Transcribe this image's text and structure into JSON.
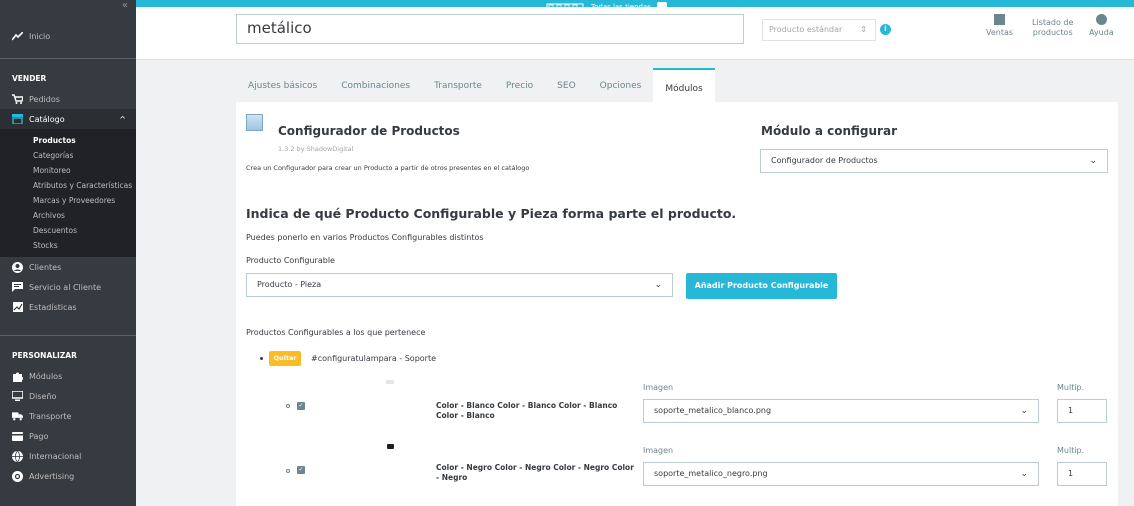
{
  "sidebar": {
    "collapse": "«",
    "home": "Inicio",
    "sell_section": "VENDER",
    "orders": "Pedidos",
    "catalog": "Catálogo",
    "catalog_sub": [
      "Productos",
      "Categorías",
      "Monitoreo",
      "Atributos y Características",
      "Marcas y Proveedores",
      "Archivos",
      "Descuentos",
      "Stocks"
    ],
    "clients": "Clientes",
    "customer_service": "Servicio al Cliente",
    "stats": "Estadísticas",
    "customize_section": "PERSONALIZAR",
    "modules": "Módulos",
    "design": "Diseño",
    "shipping": "Transporte",
    "payment": "Pago",
    "international": "Internacional",
    "advertising": "Advertising"
  },
  "header": {
    "store_toggle_label": "Todas las tiendas",
    "product_name": "metálico",
    "product_type": "Producto estándar",
    "sales": "Ventas",
    "product_list_line1": "Listado de",
    "product_list_line2": "productos",
    "help": "Ayuda"
  },
  "tabs": [
    "Ajustes básicos",
    "Combinaciones",
    "Transporte",
    "Precio",
    "SEO",
    "Opciones",
    "Módulos"
  ],
  "module": {
    "title": "Configurador de Productos",
    "version": "1.3.2 by ShadowDigital",
    "description": "Crea un Configurador para crear un Producto a partir de otros presentes en el catálogo",
    "configure_title": "Módulo a configurar",
    "configure_select": "Configurador de Productos"
  },
  "section": {
    "heading": "Indica de qué Producto Configurable y Pieza forma parte el producto.",
    "help": "Puedes ponerlo en varios Productos Configurables distintos",
    "select_label": "Producto Configurable",
    "select_value": "Producto - Pieza",
    "add_button": "Añadir Producto Configurable",
    "belongs_label": "Productos Configurables a los que pertenece",
    "remove_button": "Quitar",
    "item_name": "#configuratulampara - Soporte"
  },
  "combos": [
    {
      "label": "Color - Blanco Color - Blanco Color - Blanco Color - Blanco",
      "image_label": "Imagen",
      "image": "soporte_metalico_blanco.png",
      "multip_label": "Multip.",
      "multip": "1",
      "swatch": "#e3e6e8"
    },
    {
      "label": "Color - Negro Color - Negro Color - Negro Color - Negro",
      "image_label": "Imagen",
      "image": "soporte_metalico_negro.png",
      "multip_label": "Multip.",
      "multip": "1",
      "swatch": "#1e1e1e"
    }
  ],
  "colors": {
    "accent": "#25b9d7",
    "sidebar": "#363a41",
    "warning": "#fbbb22"
  }
}
